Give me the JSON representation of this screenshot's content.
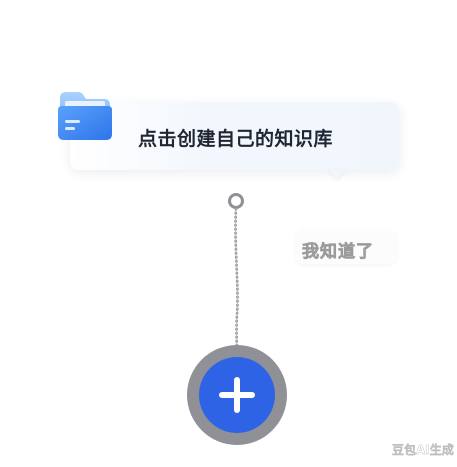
{
  "tooltip": {
    "text": "点击创建自己的知识库"
  },
  "got_it": {
    "label": "我知道了"
  },
  "watermark": {
    "text": "豆包AI生成"
  },
  "icons": {
    "folder": "folder-icon",
    "plus": "plus-icon",
    "chain": "chain-icon"
  },
  "colors": {
    "accent": "#2f63e6",
    "ring": "#8f9196",
    "text": "#1f2533",
    "folder_light": "#8fc3ff",
    "folder_dark": "#3f86f2"
  }
}
